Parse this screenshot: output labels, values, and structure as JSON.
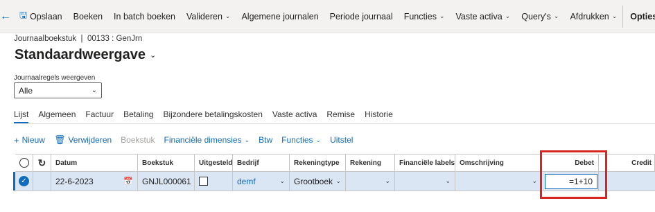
{
  "toolbar": {
    "back_icon": "arrow-left-icon",
    "save": "Opslaan",
    "boeken": "Boeken",
    "batch": "In batch boeken",
    "valideren": "Valideren",
    "algemene": "Algemene journalen",
    "periode": "Periode journaal",
    "functies": "Functies",
    "vaste_activa": "Vaste activa",
    "queries": "Query's",
    "afdrukken": "Afdrukken",
    "opties": "Opties"
  },
  "breadcrumb": {
    "part1": "Journaalboekstuk",
    "sep": "|",
    "part2": "00133 : GenJrn"
  },
  "page_title": "Standaardweergave",
  "filter": {
    "label": "Journaalregels weergeven",
    "value": "Alle"
  },
  "tabs": [
    "Lijst",
    "Algemeen",
    "Factuur",
    "Betaling",
    "Bijzondere betalingskosten",
    "Vaste activa",
    "Remise",
    "Historie"
  ],
  "actions": {
    "nieuw": "Nieuw",
    "verwijderen": "Verwijderen",
    "boekstuk": "Boekstuk",
    "fin_dim": "Financiële dimensies",
    "btw": "Btw",
    "functies": "Functies",
    "uitstel": "Uitstel"
  },
  "grid": {
    "headers": {
      "datum": "Datum",
      "boekstuk": "Boekstuk",
      "uitgesteld": "Uitgesteld",
      "bedrijf": "Bedrijf",
      "rekeningtype": "Rekeningtype",
      "rekening": "Rekening",
      "fin_labels": "Financiële labels",
      "omschrijving": "Omschrijving",
      "debet": "Debet",
      "credit": "Credit"
    },
    "row": {
      "datum": "22-6-2023",
      "boekstuk": "GNJL000061",
      "bedrijf": "demf",
      "rekeningtype": "Grootboek",
      "debet": "=1+10"
    }
  },
  "colors": {
    "accent": "#0f6cbd",
    "selected_row": "#dbe6f5",
    "highlight": "#d6261f"
  }
}
